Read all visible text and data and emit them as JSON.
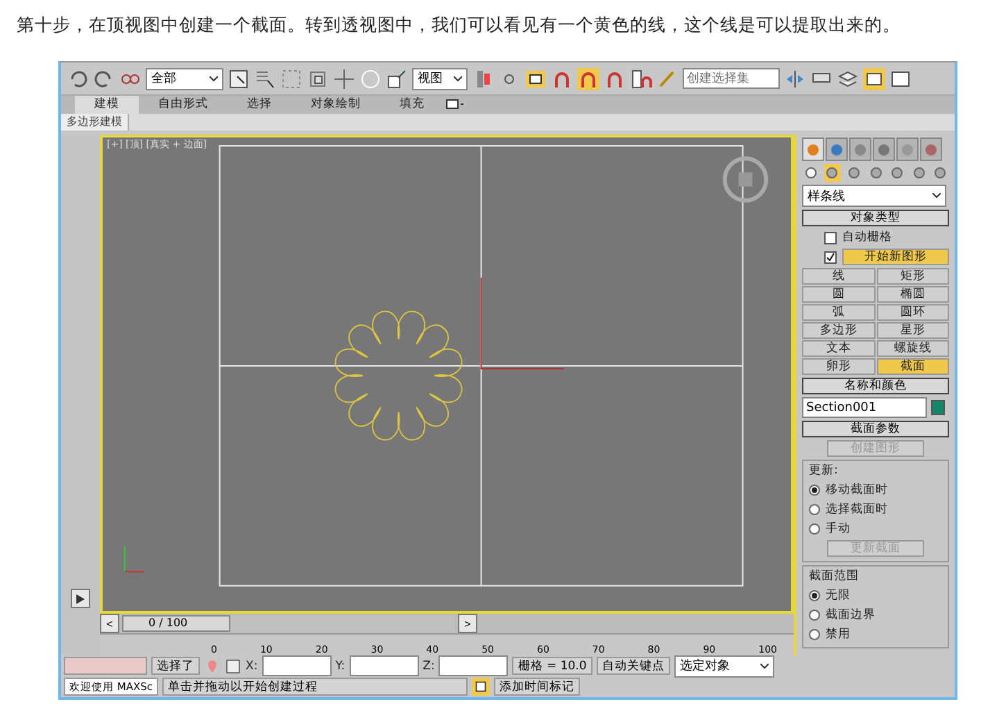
{
  "caption": "第十步，在顶视图中创建一个截面。转到透视图中，我们可以看见有一个黄色的线，这个线是可以提取出来的。",
  "toolbar": {
    "selection_filter": "全部",
    "reference_coord": "视图",
    "named_selection_placeholder": "创建选择集"
  },
  "ribbon_tabs": [
    {
      "label": "建模",
      "selected": true
    },
    {
      "label": "自由形式",
      "selected": false
    },
    {
      "label": "选择",
      "selected": false
    },
    {
      "label": "对象绘制",
      "selected": false
    },
    {
      "label": "填充",
      "selected": false
    }
  ],
  "ribbon_panel": "多边形建模",
  "viewport": {
    "label": "[+] [顶] [真实 + 边面]"
  },
  "command_panel": {
    "tabs": [
      {
        "selected": true
      },
      {
        "selected": false
      },
      {
        "selected": false
      },
      {
        "selected": false
      },
      {
        "selected": false
      },
      {
        "selected": false
      }
    ],
    "categories": [
      {
        "selected": false
      },
      {
        "selected": true
      },
      {
        "selected": false
      },
      {
        "selected": false
      },
      {
        "selected": false
      },
      {
        "selected": false
      },
      {
        "selected": false
      }
    ],
    "type_dropdown": "样条线",
    "object_type": {
      "title": "对象类型",
      "auto_grid": {
        "label": "自动栅格",
        "checked": false
      },
      "start_new_shape": {
        "label": "开始新图形",
        "checked": true
      },
      "buttons": [
        {
          "label": "线",
          "selected": false
        },
        {
          "label": "矩形",
          "selected": false
        },
        {
          "label": "圆",
          "selected": false
        },
        {
          "label": "椭圆",
          "selected": false
        },
        {
          "label": "弧",
          "selected": false
        },
        {
          "label": "圆环",
          "selected": false
        },
        {
          "label": "多边形",
          "selected": false
        },
        {
          "label": "星形",
          "selected": false
        },
        {
          "label": "文本",
          "selected": false
        },
        {
          "label": "螺旋线",
          "selected": false
        },
        {
          "label": "卵形",
          "selected": false
        },
        {
          "label": "截面",
          "selected": true
        }
      ]
    },
    "name_and_color": {
      "title": "名称和颜色",
      "name": "Section001",
      "color": "#12876c"
    },
    "section_parameters": {
      "title": "截面参数",
      "create_button": {
        "label": "创建图形",
        "disabled": true
      },
      "update": {
        "title": "更新:",
        "options": [
          {
            "label": "移动截面时",
            "selected": true
          },
          {
            "label": "选择截面时",
            "selected": false
          },
          {
            "label": "手动",
            "selected": false
          }
        ],
        "button": {
          "label": "更新截面",
          "disabled": true
        }
      },
      "extents": {
        "title": "截面范围",
        "options": [
          {
            "label": "无限",
            "selected": true
          },
          {
            "label": "截面边界",
            "selected": false
          },
          {
            "label": "禁用",
            "selected": false
          }
        ]
      }
    }
  },
  "timeline": {
    "position": "0 / 100",
    "level": 0,
    "prev": "<",
    "next": ">",
    "ticks": [
      "0",
      "10",
      "20",
      "30",
      "40",
      "50",
      "60",
      "70",
      "80",
      "90",
      "100"
    ]
  },
  "status": {
    "selected": "选择了",
    "x_label": "X:",
    "y_label": "Y:",
    "z_label": "Z:",
    "grid": "栅格 = 10.0",
    "auto_key": "自动关键点",
    "key_filter": "选定对象",
    "welcome": "欢迎使用 MAXSc",
    "prompt": "单击并拖动以开始创建过程",
    "add_time_tag": "添加时间标记"
  }
}
